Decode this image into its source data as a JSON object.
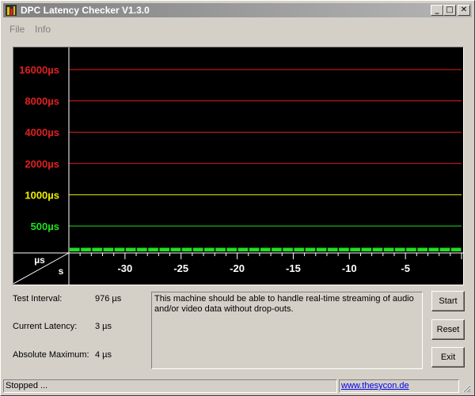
{
  "window": {
    "title": "DPC Latency Checker V1.3.0",
    "controls": {
      "minimize": "_",
      "maximize": "□",
      "close": "✕"
    }
  },
  "menu": {
    "items": [
      "File",
      "Info"
    ]
  },
  "chart": {
    "colors": {
      "background": "#000000",
      "red": "#e02020",
      "yellow": "#f0f000",
      "green": "#20e020",
      "axis": "#ffffff"
    }
  },
  "chart_data": {
    "type": "bar",
    "title": "",
    "y_tick_labels": [
      {
        "label": "16000µs",
        "value": 16000,
        "color": "red"
      },
      {
        "label": "8000µs",
        "value": 8000,
        "color": "red"
      },
      {
        "label": "4000µs",
        "value": 4000,
        "color": "red"
      },
      {
        "label": "2000µs",
        "value": 2000,
        "color": "red"
      },
      {
        "label": "1000µs",
        "value": 1000,
        "color": "yellow"
      },
      {
        "label": "500µs",
        "value": 500,
        "color": "green"
      }
    ],
    "x_tick_labels": [
      -30,
      -25,
      -20,
      -15,
      -10,
      -5
    ],
    "x_range": [
      -35,
      0
    ],
    "y_unit_label": "µs",
    "x_unit_label": "s",
    "grid": true,
    "series": [
      {
        "values": [
          3,
          3,
          3,
          3,
          3,
          3,
          3,
          3,
          3,
          3,
          3,
          3,
          3,
          3,
          3,
          3,
          3,
          3,
          3,
          3,
          3,
          3,
          3,
          3,
          3,
          3,
          3,
          3,
          3,
          3,
          3,
          3,
          3,
          3,
          3
        ]
      }
    ]
  },
  "stats": {
    "test_interval": {
      "label": "Test Interval:",
      "value": "976 µs"
    },
    "current_latency": {
      "label": "Current Latency:",
      "value": "3 µs"
    },
    "absolute_maximum": {
      "label": "Absolute Maximum:",
      "value": "4 µs"
    }
  },
  "message": "This machine should be able to handle real-time streaming of audio and/or video data without drop-outs.",
  "buttons": {
    "start": "Start",
    "reset": "Reset",
    "exit": "Exit"
  },
  "status": {
    "text": "Stopped ...",
    "link": "www.thesycon.de"
  }
}
